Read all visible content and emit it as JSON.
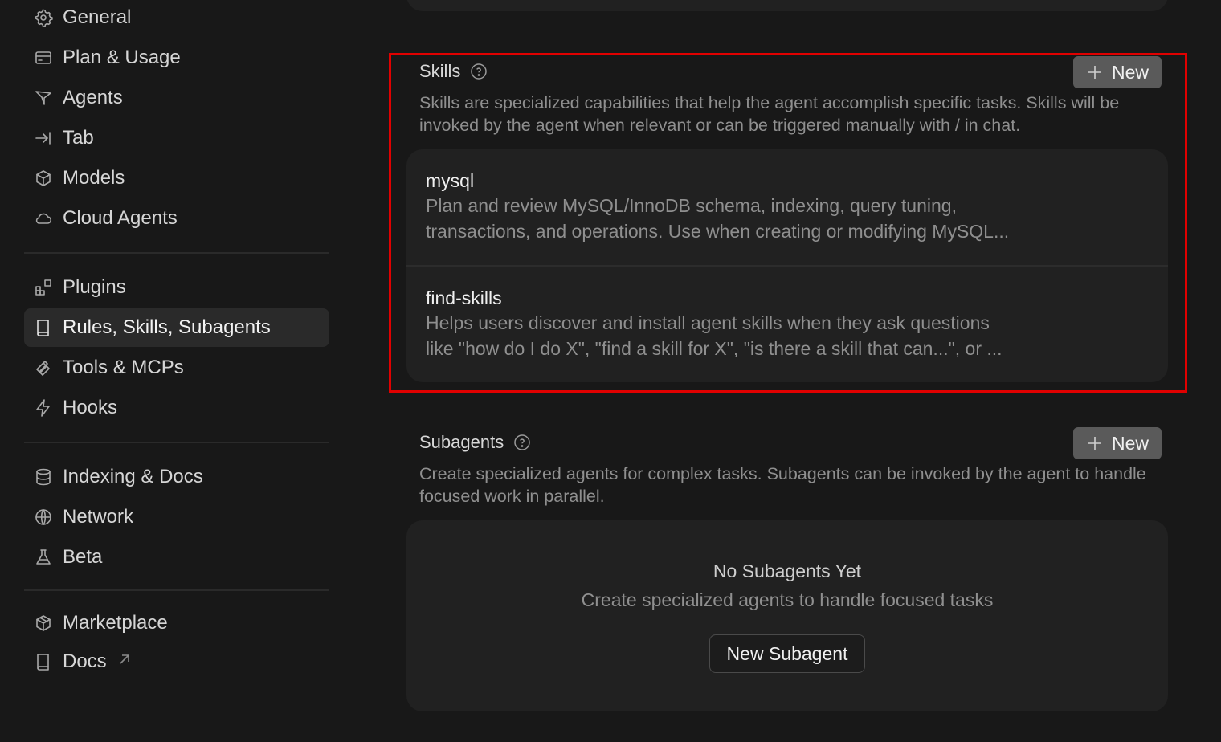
{
  "sidebar": {
    "groups": [
      [
        {
          "label": "General",
          "icon": "gear-icon"
        },
        {
          "label": "Plan & Usage",
          "icon": "card-icon"
        },
        {
          "label": "Agents",
          "icon": "agents-icon"
        },
        {
          "label": "Tab",
          "icon": "tab-icon"
        },
        {
          "label": "Models",
          "icon": "cube-icon"
        },
        {
          "label": "Cloud Agents",
          "icon": "cloud-icon"
        }
      ],
      [
        {
          "label": "Plugins",
          "icon": "plugins-icon"
        },
        {
          "label": "Rules, Skills, Subagents",
          "icon": "book-icon",
          "active": true
        },
        {
          "label": "Tools & MCPs",
          "icon": "tools-icon"
        },
        {
          "label": "Hooks",
          "icon": "bolt-icon"
        }
      ],
      [
        {
          "label": "Indexing & Docs",
          "icon": "database-icon"
        },
        {
          "label": "Network",
          "icon": "globe-icon"
        },
        {
          "label": "Beta",
          "icon": "flask-icon"
        }
      ],
      [
        {
          "label": "Marketplace",
          "icon": "package-icon"
        },
        {
          "label": "Docs",
          "icon": "book-icon",
          "external": true
        }
      ]
    ]
  },
  "skills": {
    "title": "Skills",
    "new_label": "New",
    "description": "Skills are specialized capabilities that help the agent accomplish specific tasks. Skills will be invoked by the agent when relevant or can be triggered manually with / in chat.",
    "items": [
      {
        "name": "mysql",
        "desc_line1": "Plan and review MySQL/InnoDB schema, indexing, query tuning,",
        "desc_line2": "transactions, and operations. Use when creating or modifying MySQL..."
      },
      {
        "name": "find-skills",
        "desc_line1": "Helps users discover and install agent skills when they ask questions",
        "desc_line2": "like \"how do I do X\", \"find a skill for X\", \"is there a skill that can...\", or ..."
      }
    ]
  },
  "subagents": {
    "title": "Subagents",
    "new_label": "New",
    "description": "Create specialized agents for complex tasks. Subagents can be invoked by the agent to handle focused work in parallel.",
    "empty_title": "No Subagents Yet",
    "empty_subtitle": "Create specialized agents to handle focused tasks",
    "new_subagent_label": "New Subagent"
  },
  "colors": {
    "background": "#181818",
    "card": "#212121",
    "highlight": "#e00000",
    "button": "#5a5a5a"
  }
}
